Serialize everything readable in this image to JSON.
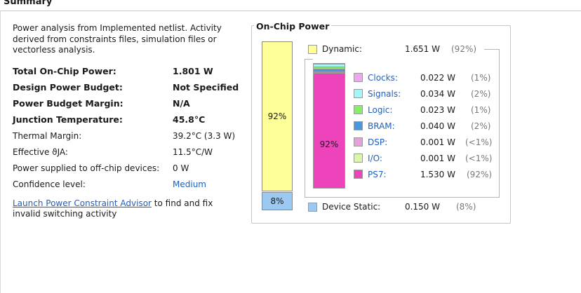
{
  "header": {
    "title": "Summary"
  },
  "description": "Power analysis from Implemented netlist. Activity derived from constraints files, simulation files or vectorless analysis.",
  "summary": [
    {
      "label": "Total On-Chip Power:",
      "value": "1.801 W",
      "bold": true
    },
    {
      "label": "Design Power Budget:",
      "value": "Not Specified",
      "bold": true
    },
    {
      "label": "Power Budget Margin:",
      "value": "N/A",
      "bold": true
    },
    {
      "label": "Junction Temperature:",
      "value": "45.8°C",
      "bold": true
    },
    {
      "label": "Thermal Margin:",
      "value": "39.2°C (3.3 W)",
      "bold": false
    },
    {
      "label": "Effective ϑJA:",
      "value": "11.5°C/W",
      "bold": false
    },
    {
      "label": "Power supplied to off-chip devices:",
      "value": "0 W",
      "bold": false
    },
    {
      "label": "Confidence level:",
      "value": "Medium",
      "bold": false,
      "link": true
    }
  ],
  "advisor": {
    "link_text": "Launch Power Constraint Advisor",
    "rest_text": " to find and fix invalid switching activity"
  },
  "on_chip": {
    "title": "On-Chip Power",
    "dynamic": {
      "label": "Dynamic:",
      "power": "1.651 W",
      "percent": "(92%)",
      "bar_label": "92%",
      "color": "#ffff99"
    },
    "static": {
      "label": "Device Static:",
      "power": "0.150 W",
      "percent": "(8%)",
      "bar_label": "8%",
      "color": "#9cc9f2"
    },
    "ps7_bar_label": "92%",
    "components": [
      {
        "name": "Clocks:",
        "power": "0.022 W",
        "percent": "(1%)",
        "color": "#f3a6f0",
        "share": 0.013
      },
      {
        "name": "Signals:",
        "power": "0.034 W",
        "percent": "(2%)",
        "color": "#a6f6f6",
        "share": 0.021
      },
      {
        "name": "Logic:",
        "power": "0.023 W",
        "percent": "(1%)",
        "color": "#88ee66",
        "share": 0.014
      },
      {
        "name": "BRAM:",
        "power": "0.040 W",
        "percent": "(2%)",
        "color": "#4a97e0",
        "share": 0.024
      },
      {
        "name": "DSP:",
        "power": "0.001 W",
        "percent": "(<1%)",
        "color": "#e6a0da",
        "share": 0.008
      },
      {
        "name": "I/O:",
        "power": "0.001 W",
        "percent": "(<1%)",
        "color": "#d8f7a8",
        "share": 0.008
      },
      {
        "name": "PS7:",
        "power": "1.530 W",
        "percent": "(92%)",
        "color": "#ee44bb",
        "share": 0.927
      }
    ]
  }
}
